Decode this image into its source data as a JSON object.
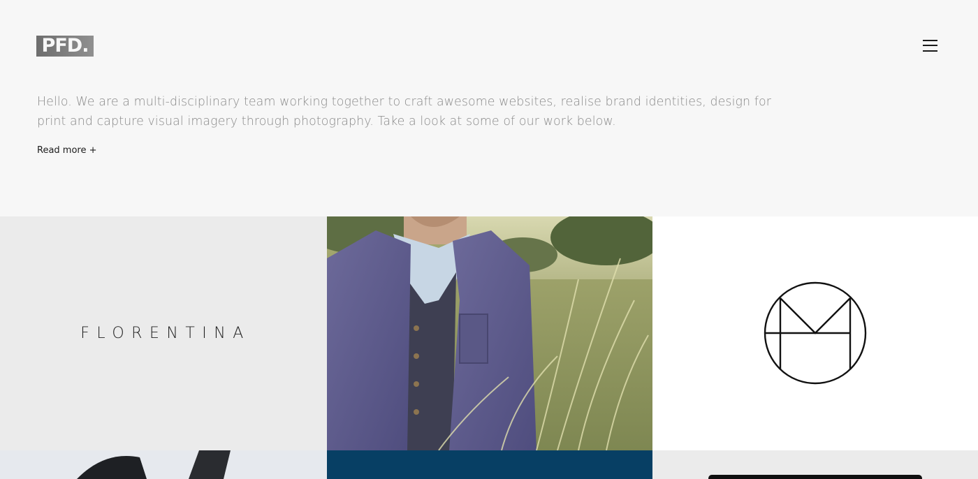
{
  "header": {
    "logo_text": "PFD.",
    "menu_icon": "hamburger-menu-icon"
  },
  "intro": {
    "text": "Hello. We are a multi-disciplinary team working together to craft awesome websites, realise brand identities, design for print and capture visual imagery through photography. Take a look at some of our work below.",
    "read_more": "Read more +"
  },
  "portfolio": {
    "tiles": [
      {
        "name": "florentina",
        "wordmark": "FLORENTINA",
        "background": "#ebebeb"
      },
      {
        "name": "man-in-field-photo",
        "background": "#8c9466"
      },
      {
        "name": "m-monogram-logo",
        "background": "#ffffff",
        "icon": "m-monogram-icon"
      },
      {
        "name": "camera-photo",
        "background": "#e6e9ee"
      },
      {
        "name": "navy-tile",
        "background": "#073f64"
      },
      {
        "name": "device-tile",
        "background": "#ebebeb"
      }
    ]
  },
  "colors": {
    "page_background": "#f7f7f7",
    "intro_text": "#8a8a8a",
    "link_text": "#1c1c1c",
    "navy": "#073f64"
  }
}
